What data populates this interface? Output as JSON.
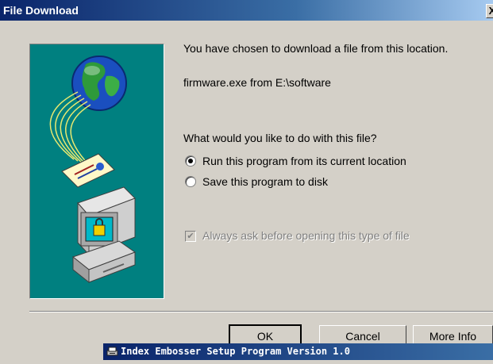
{
  "window": {
    "title": "File Download",
    "close_glyph": "X"
  },
  "dialog": {
    "intro": "You have chosen to download a file from this location.",
    "file_info": "firmware.exe from E:\\software",
    "question": "What would you like to do with this file?",
    "options": [
      {
        "label": "Run this program from its current location",
        "selected": true
      },
      {
        "label": "Save this program to disk",
        "selected": false
      }
    ],
    "always_ask": {
      "label": "Always ask before opening this type of file",
      "checked": true,
      "enabled": false
    }
  },
  "buttons": {
    "ok": "OK",
    "cancel": "Cancel",
    "more_info": "More Info"
  },
  "taskbar": {
    "title": "Index Embosser Setup Program Version 1.0"
  },
  "colors": {
    "title_gradient_start": "#0a246a",
    "dialog_bg": "#d4d0c8",
    "illustration_bg": "#008080"
  },
  "icons": [
    "globe-icon",
    "document-icon",
    "computer-lock-icon",
    "close-icon",
    "setup-icon"
  ]
}
